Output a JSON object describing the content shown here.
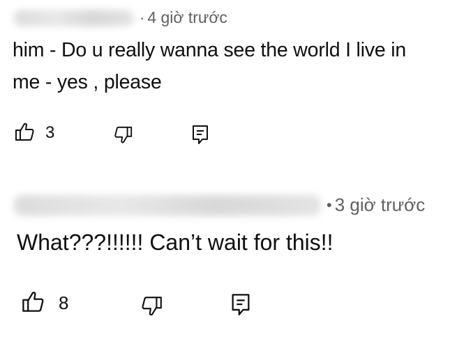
{
  "comments": [
    {
      "separator": "·",
      "timestamp": "4 giờ trước",
      "lines": [
        "him - Do u really wanna see the world I live in",
        "me - yes , please"
      ],
      "like_count": "3",
      "icons": [
        "thumbs-up-icon",
        "thumbs-down-icon",
        "reply-icon"
      ]
    },
    {
      "separator": "•",
      "timestamp": "3 giờ trước",
      "lines": [
        "What???!!!!!! Can’t wait for this!!"
      ],
      "like_count": "8",
      "icons": [
        "thumbs-up-icon",
        "thumbs-down-icon",
        "reply-icon"
      ]
    }
  ]
}
